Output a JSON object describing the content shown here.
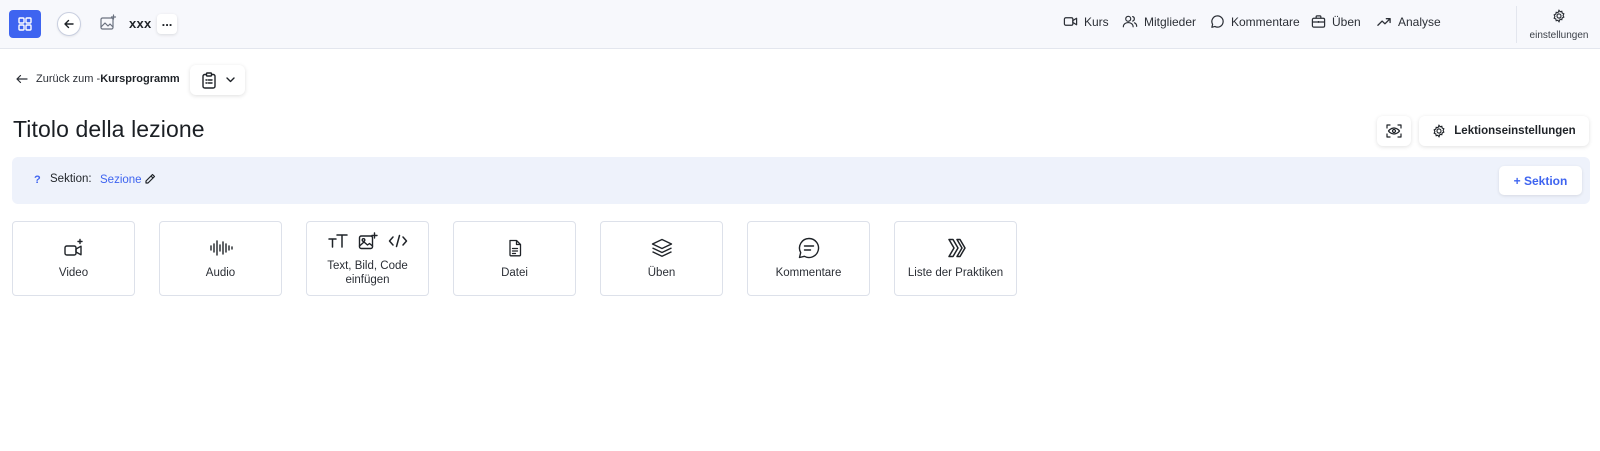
{
  "topbar": {
    "course_name": "xxx",
    "more_label": "...",
    "nav": [
      {
        "label": "Kurs",
        "icon": "video-icon"
      },
      {
        "label": "Mitglieder",
        "icon": "members-icon"
      },
      {
        "label": "Kommentare",
        "icon": "comment-icon"
      },
      {
        "label": "Üben",
        "icon": "briefcase-icon"
      },
      {
        "label": "Analyse",
        "icon": "trend-icon"
      }
    ],
    "settings_label": "einstellungen"
  },
  "breadcrumb": {
    "prefix": "Zurück zum -",
    "target": "Kursprogramm"
  },
  "lesson": {
    "title": "Titolo della lezione",
    "settings_button": "Lektionseinstellungen"
  },
  "section": {
    "help": "?",
    "label": "Sektion:",
    "name": "Sezione",
    "add_button": "+ Sektion"
  },
  "tiles": [
    {
      "label": "Video",
      "icon": "video-add-icon"
    },
    {
      "label": "Audio",
      "icon": "audio-wave-icon"
    },
    {
      "label": "Text, Bild, Code einfügen",
      "icon": "text-image-code-icon"
    },
    {
      "label": "Datei",
      "icon": "file-icon"
    },
    {
      "label": "Üben",
      "icon": "layers-icon"
    },
    {
      "label": "Kommentare",
      "icon": "comment-icon"
    },
    {
      "label": "Liste der Praktiken",
      "icon": "list-chevrons-icon"
    }
  ],
  "colors": {
    "accent": "#3e64f0",
    "topbar_bg": "#f7f8fc",
    "section_bg": "#eef2fb"
  }
}
